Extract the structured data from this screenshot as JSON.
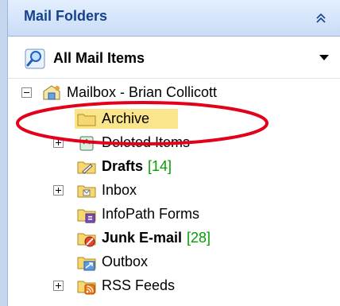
{
  "header": {
    "title": "Mail Folders"
  },
  "view": {
    "label": "All Mail Items"
  },
  "mailbox": {
    "label": "Mailbox - Brian Collicott"
  },
  "folders": [
    {
      "name": "Archive",
      "count": ""
    },
    {
      "name": "Deleted Items",
      "count": ""
    },
    {
      "name": "Drafts",
      "count": "[14]"
    },
    {
      "name": "Inbox",
      "count": ""
    },
    {
      "name": "InfoPath Forms",
      "count": ""
    },
    {
      "name": "Junk E-mail",
      "count": "[28]"
    },
    {
      "name": "Outbox",
      "count": ""
    },
    {
      "name": "RSS Feeds",
      "count": ""
    }
  ],
  "colors": {
    "header_text": "#15428b",
    "selection": "#fbe58c",
    "annotation": "#e3001b",
    "count": "#00a000"
  }
}
